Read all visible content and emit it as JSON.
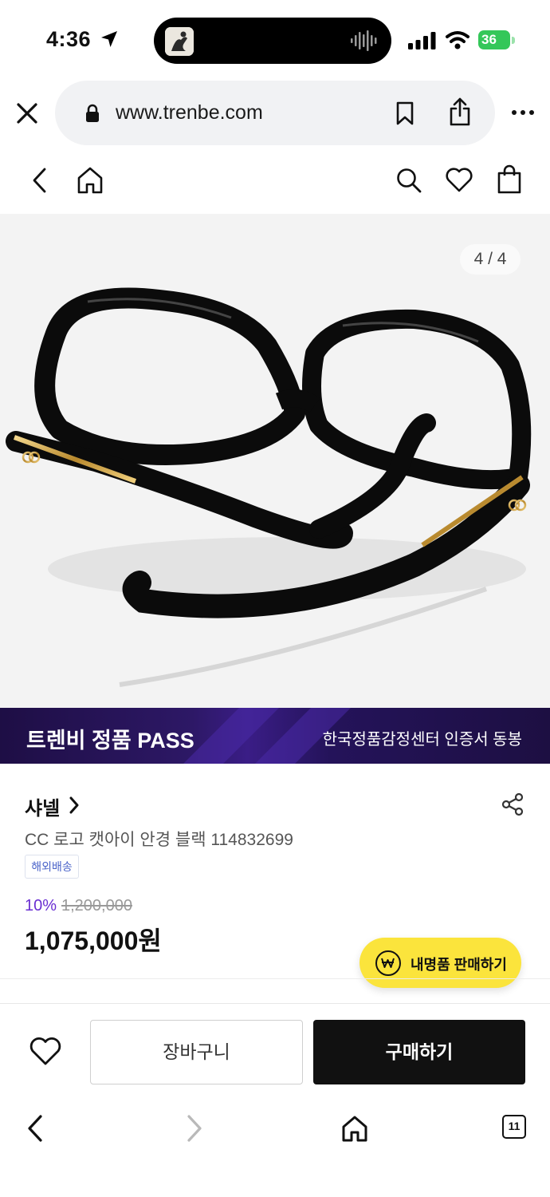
{
  "status": {
    "time": "4:36",
    "battery": "36"
  },
  "browser": {
    "url": "www.trenbe.com"
  },
  "gallery": {
    "counter": "4 / 4"
  },
  "pass_banner": {
    "title": "트렌비 정품 PASS",
    "subtitle": "한국정품감정센터 인증서 동봉"
  },
  "product": {
    "brand": "샤넬",
    "name": "CC 로고 캣아이 안경 블랙 114832699",
    "tag": "해외배송",
    "discount": "10%",
    "original_price": "1,200,000",
    "price": "1,075,000원"
  },
  "sell_button": {
    "label": "내명품 판매하기"
  },
  "actions": {
    "cart": "장바구니",
    "buy": "구매하기"
  },
  "toolbar": {
    "tabs_count": "11"
  }
}
